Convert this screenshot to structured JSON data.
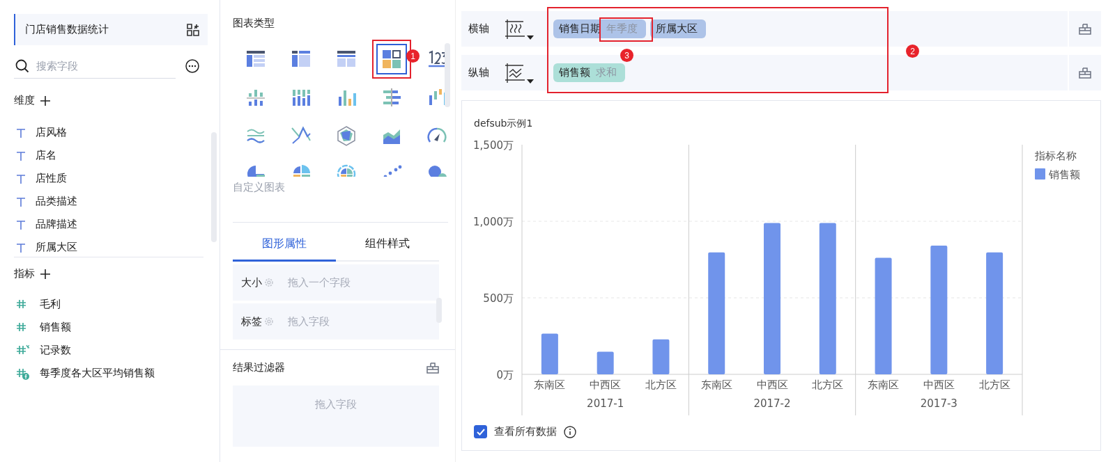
{
  "dataset": {
    "title": "门店销售数据统计"
  },
  "search": {
    "placeholder": "搜索字段"
  },
  "dimensions": {
    "title": "维度",
    "items": [
      {
        "label": "店风格"
      },
      {
        "label": "店名"
      },
      {
        "label": "店性质"
      },
      {
        "label": "品类描述"
      },
      {
        "label": "品牌描述"
      },
      {
        "label": "所属大区"
      }
    ]
  },
  "measures": {
    "title": "指标",
    "items": [
      {
        "label": "毛利",
        "kind": "plain"
      },
      {
        "label": "销售额",
        "kind": "plain"
      },
      {
        "label": "记录数",
        "kind": "count"
      },
      {
        "label": "每季度各大区平均销售额",
        "kind": "formula"
      }
    ]
  },
  "chart_types": {
    "title": "图表类型",
    "items": [
      {
        "selected": false
      },
      {
        "selected": false
      },
      {
        "selected": false
      },
      {
        "selected": true,
        "callout": "1"
      },
      {
        "selected": false
      },
      {
        "selected": false
      },
      {
        "selected": false
      },
      {
        "selected": false
      },
      {
        "selected": false
      },
      {
        "selected": false
      },
      {
        "selected": false
      },
      {
        "selected": false
      },
      {
        "selected": false
      },
      {
        "selected": false
      },
      {
        "selected": false
      },
      {
        "selected": false
      },
      {
        "selected": false
      },
      {
        "selected": false
      },
      {
        "selected": false
      },
      {
        "selected": false
      }
    ],
    "custom_label": "自定义图表"
  },
  "property_tabs": [
    {
      "label": "图形属性",
      "selected": true
    },
    {
      "label": "组件样式",
      "selected": false
    }
  ],
  "properties": [
    {
      "label": "大小",
      "placeholder": "拖入一个字段"
    },
    {
      "label": "标签",
      "placeholder": "拖入字段"
    }
  ],
  "result_filter": {
    "title": "结果过滤器",
    "placeholder": "拖入字段"
  },
  "axes": {
    "callout": "2",
    "rows": [
      {
        "label": "横轴",
        "kind": "x",
        "fields": [
          {
            "name": "销售日期",
            "sub": "年季度",
            "kind": "dimension",
            "callout": "3"
          },
          {
            "name": "所属大区",
            "kind": "dimension"
          }
        ]
      },
      {
        "label": "纵轴",
        "kind": "y",
        "fields": [
          {
            "name": "销售额",
            "sub": "求和",
            "kind": "measure"
          }
        ]
      }
    ]
  },
  "chart": {
    "title": "defsub示例1",
    "legend_title": "指标名称",
    "x_groups": [
      "2017-1",
      "2017-2",
      "2017-3"
    ],
    "chart_data": {
      "type": "bar",
      "categories": [
        "东南区",
        "中西区",
        "北方区",
        "东南区",
        "中西区",
        "北方区",
        "东南区",
        "中西区",
        "北方区"
      ],
      "series": [
        {
          "name": "销售额",
          "color": "#7094eb",
          "values": [
            266,
            148,
            228,
            797,
            989,
            989,
            761,
            841,
            797
          ]
        }
      ],
      "ylim": [
        0,
        1500
      ],
      "yticks": [
        {
          "value": 0,
          "label": "0万"
        },
        {
          "value": 500,
          "label": "500万"
        },
        {
          "value": 1000,
          "label": "1,000万"
        },
        {
          "value": 1500,
          "label": "1,500万"
        }
      ]
    },
    "show_all": {
      "label": "查看所有数据",
      "checked": true
    }
  }
}
